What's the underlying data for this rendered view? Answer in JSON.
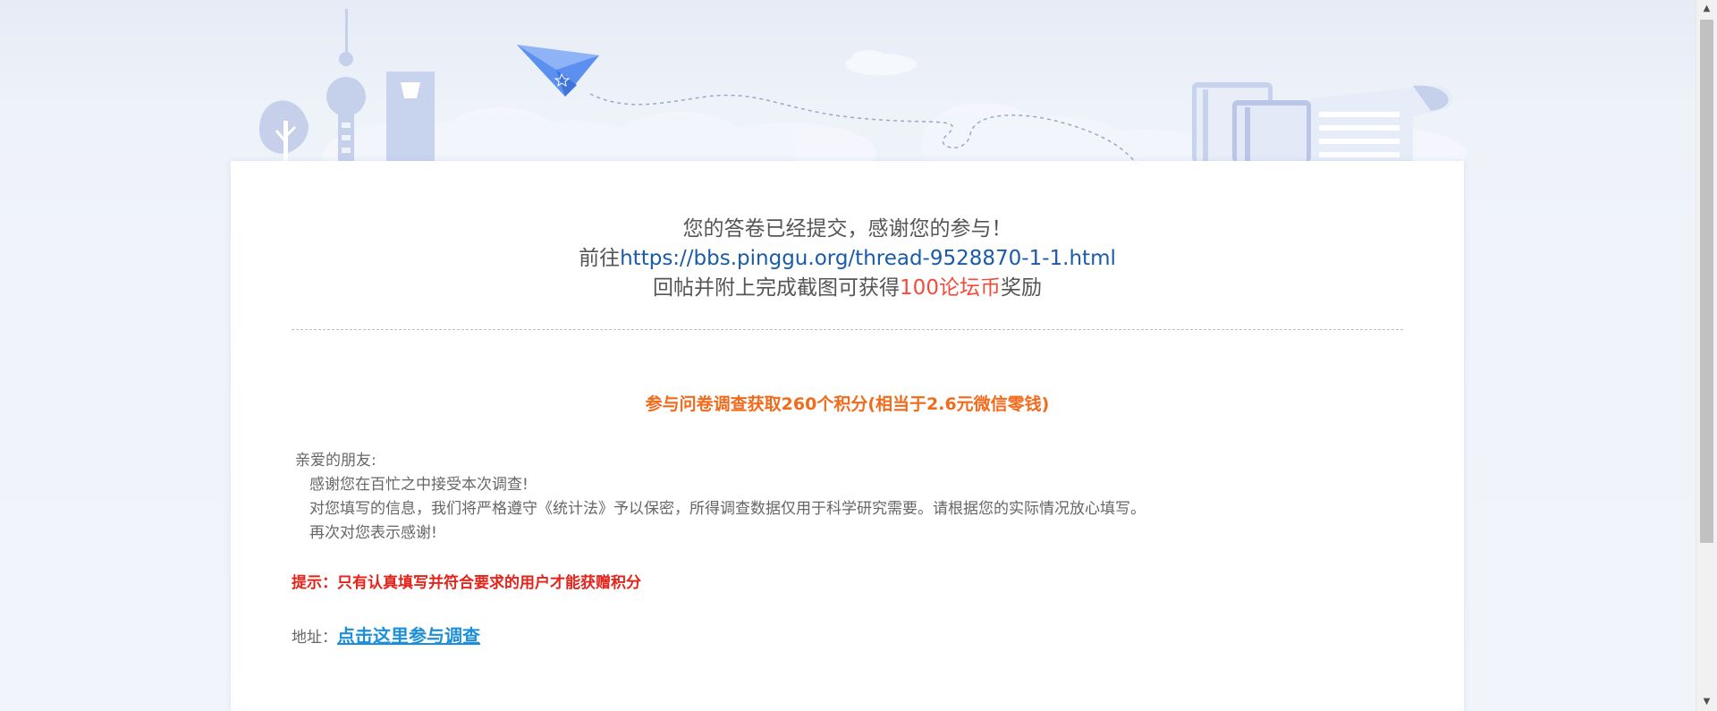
{
  "message": {
    "line1": "您的答卷已经提交，感谢您的参与！",
    "goto_prefix": "前往",
    "thread_url": "https://bbs.pinggu.org/thread-9528870-1-1.html",
    "line3_prefix": "回帖并附上完成截图可获得",
    "reward": "100论坛币",
    "line3_suffix": "奖励"
  },
  "survey": {
    "title": "参与问卷调查获取260个积分(相当于2.6元微信零钱)",
    "greeting": "亲爱的朋友:",
    "paragraphs": [
      "感谢您在百忙之中接受本次调查!",
      "对您填写的信息，我们将严格遵守《统计法》予以保密，所得调查数据仅用于科学研究需要。请根据您的实际情况放心填写。",
      "再次对您表示感谢!"
    ],
    "tip": "提示：只有认真填写并符合要求的用户才能获赠积分",
    "address_label": "地址：",
    "address_link": "点击这里参与调查"
  },
  "icons": {
    "paper_plane": "paper-plane-icon",
    "scroll_up": "scroll-up-arrow-icon",
    "scroll_down": "scroll-down-arrow-icon"
  },
  "colors": {
    "accent_orange": "#f26a1b",
    "link_blue": "#1a5ba8",
    "tip_red": "#e4231a",
    "reward_red": "#f44b3b",
    "illustration_blue": "#c0cce8"
  }
}
